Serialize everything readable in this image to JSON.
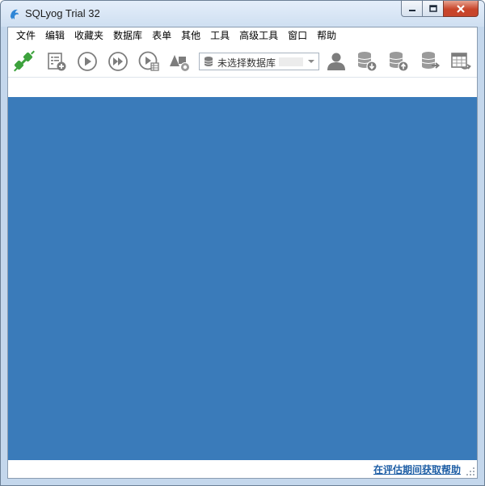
{
  "window": {
    "title": "SQLyog Trial 32"
  },
  "menu": {
    "items": [
      "文件",
      "编辑",
      "收藏夹",
      "数据库",
      "表单",
      "其他",
      "工具",
      "高级工具",
      "窗口",
      "帮助"
    ]
  },
  "toolbar": {
    "icons": [
      "connect-icon",
      "new-query-icon",
      "execute-icon",
      "execute-all-icon",
      "execute-edit-icon",
      "schema-designer-icon",
      "user-manager-icon",
      "backup-db-icon",
      "restore-db-icon",
      "export-db-icon",
      "table-data-icon"
    ],
    "db_select": {
      "selected": "未选择数据库"
    }
  },
  "status": {
    "help_link": "在评估期间获取帮助"
  },
  "colors": {
    "main_area": "#3a7bba",
    "accent_green": "#3da23d",
    "icon_gray": "#7d7d7d",
    "link_blue": "#1f5fa6"
  }
}
